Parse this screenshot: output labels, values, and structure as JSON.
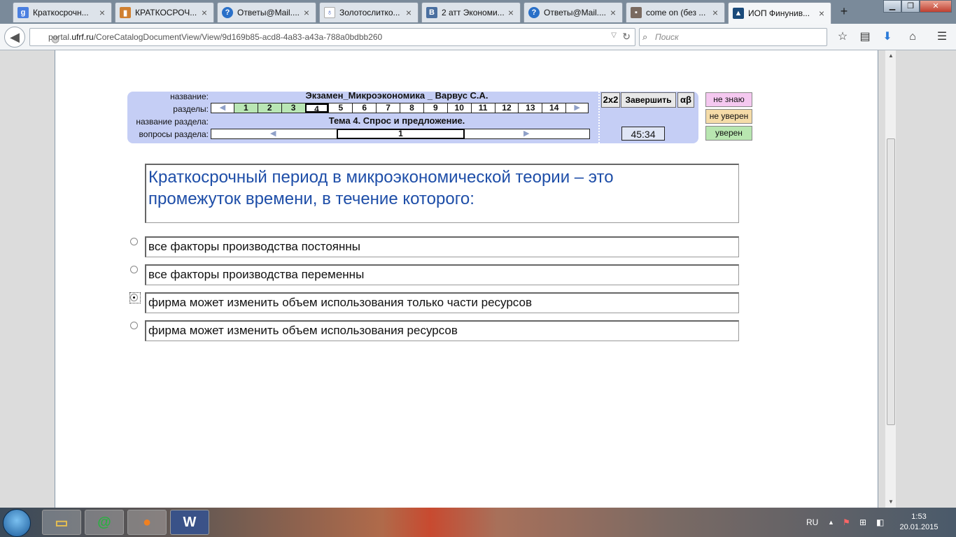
{
  "browser": {
    "tabs": [
      {
        "label": "Краткосрочн...",
        "icon": "google-icon",
        "color": "#4a7fe0"
      },
      {
        "label": "КРАТКОСРОЧ...",
        "icon": "chart-icon",
        "color": "#d08030"
      },
      {
        "label": "Ответы@Mail....",
        "icon": "question-icon",
        "color": "#2a70c8"
      },
      {
        "label": "Золотослитко...",
        "icon": "flask-icon",
        "color": "#4060c0"
      },
      {
        "label": "2 атт Экономи...",
        "icon": "vk-icon",
        "color": "#4a6fa0"
      },
      {
        "label": "Ответы@Mail....",
        "icon": "question-icon",
        "color": "#2a70c8"
      },
      {
        "label": "come on (без ...",
        "icon": "image-icon",
        "color": "#7a6a60"
      },
      {
        "label": "ИОП Финунив...",
        "icon": "mortarboard-icon",
        "color": "#1a4a7a",
        "active": true
      }
    ],
    "new_tab": "+",
    "url_prefix": "portal.",
    "url_domain": "ufrf.ru",
    "url_rest": "/CoreCatalogDocumentView/View/9d169b85-acd8-4a83-a43a-788a0bdbb260",
    "search_placeholder": "Поиск"
  },
  "exam": {
    "labels": {
      "name": "название:",
      "sections": "разделы:",
      "section_name": "название раздела:",
      "section_questions": "вопросы раздела:"
    },
    "title": "Экзамен_Микроэкономика _ Варвус С.А.",
    "sections": [
      "1",
      "2",
      "3",
      "4",
      "5",
      "6",
      "7",
      "8",
      "9",
      "10",
      "11",
      "12",
      "13",
      "14"
    ],
    "completed_sections": 3,
    "current_section": "4",
    "section_title": "Тема 4. Спрос и предложение.",
    "current_question": "1",
    "buttons": {
      "grid": "2x2",
      "finish": "Завершить",
      "alphabet": "αβ"
    },
    "timer": "45:34",
    "status_buttons": [
      {
        "label": "не знаю",
        "color": "#f5c8f0"
      },
      {
        "label": "не уверен",
        "color": "#f5dca8"
      },
      {
        "label": "уверен",
        "color": "#b8e6b0"
      }
    ]
  },
  "question": {
    "text_line1": "Краткосрочный период в микроэкономической теории – это",
    "text_line2": "промежуток времени, в течение которого:",
    "options": [
      {
        "text": "все факторы производства постоянны",
        "checked": false
      },
      {
        "text": "все факторы производства переменны",
        "checked": false
      },
      {
        "text": "фирма может изменить объем использования только части ресурсов",
        "checked": true
      },
      {
        "text": "фирма может изменить объем использования ресурсов",
        "checked": false
      }
    ]
  },
  "taskbar": {
    "lang": "RU",
    "time": "1:53",
    "date": "20.01.2015"
  }
}
